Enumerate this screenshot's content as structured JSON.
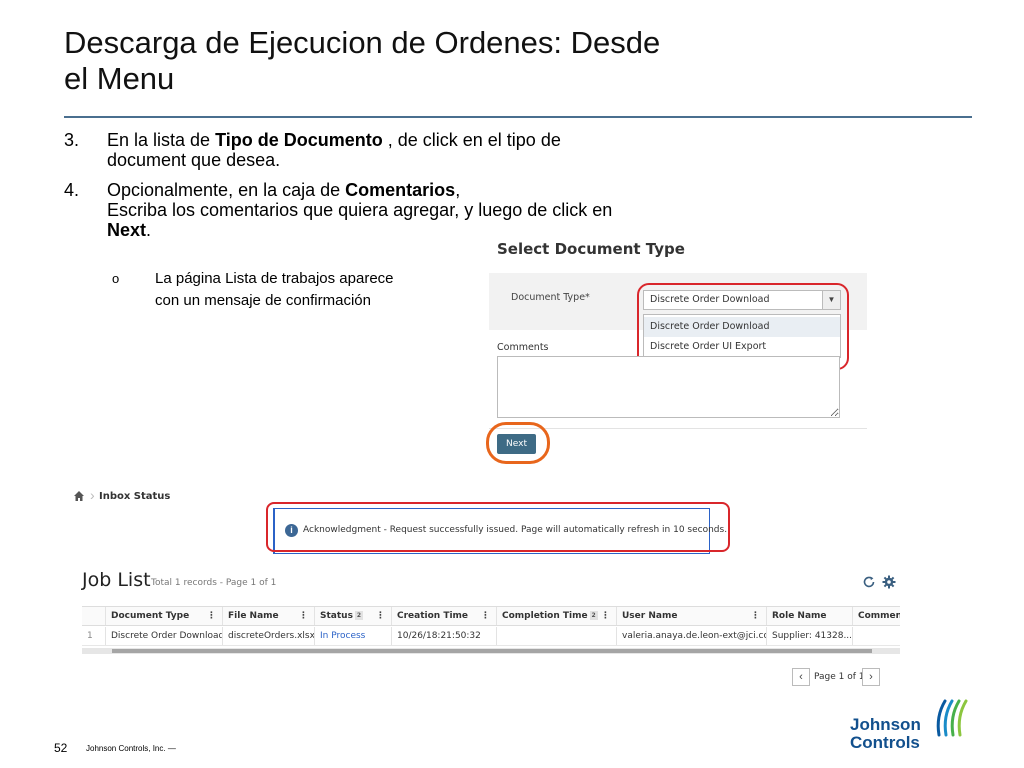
{
  "slide": {
    "title_line1": "Descarga de Ejecucion de Ordenes: Desde",
    "title_line2": "el Menu",
    "step3": {
      "num": "3.",
      "pre": "En la lista de ",
      "bold": "Tipo de Documento",
      "post": " , de click en el tipo de",
      "line2": "document que desea."
    },
    "step4": {
      "num": "4.",
      "pre": "Opcionalmente, en la caja de ",
      "bold": "Comentarios",
      "post": ",",
      "line2": "Escriba los comentarios que quiera agregar, y luego de click en",
      "line3_bold": "Next",
      "line3_post": "."
    },
    "sub": {
      "mark": "o",
      "line1": "La página Lista de trabajos aparece",
      "line2": "con un mensaje de confirmación"
    },
    "page_number": "52",
    "footer": "Johnson Controls, Inc. —",
    "logo_line1": "Johnson",
    "logo_line2": "Controls"
  },
  "select_doc": {
    "header": "Select Document Type",
    "doc_type_label": "Document Type*",
    "selected_value": "Discrete Order Download",
    "options": [
      "Discrete Order Download",
      "Discrete Order UI Export"
    ],
    "comments_label": "Comments",
    "next_label": "Next"
  },
  "inbox": {
    "breadcrumb": "Inbox Status",
    "ack_icon": "i",
    "ack_message": "Acknowledgment - Request successfully issued. Page will automatically refresh in 10 seconds."
  },
  "job_list": {
    "title": "Job List",
    "subtitle": "Total 1 records - Page 1 of 1",
    "columns": [
      "Document Type",
      "File Name",
      "Status",
      "Creation Time",
      "Completion Time",
      "User Name",
      "Role Name",
      "Comment"
    ],
    "sort_badges": {
      "status": "2",
      "completion_time": "2"
    },
    "rows": [
      {
        "index": "1",
        "document_type": "Discrete Order Download",
        "file_name": "discreteOrders.xlsx",
        "status": "In Process",
        "creation_time": "10/26/18:21:50:32",
        "completion_time": "",
        "user_name": "valeria.anaya.de.leon-ext@jci.co...",
        "role_name": "Supplier: 41328...",
        "comment": ""
      }
    ],
    "pager_text": "Page 1 of 1"
  },
  "colors": {
    "title_rule": "#4a6f8f",
    "highlight_red": "#d9262b",
    "highlight_orange": "#e8661c",
    "next_button": "#3e6b85",
    "link_blue": "#2b62c7",
    "logo_blue": "#12508d"
  }
}
